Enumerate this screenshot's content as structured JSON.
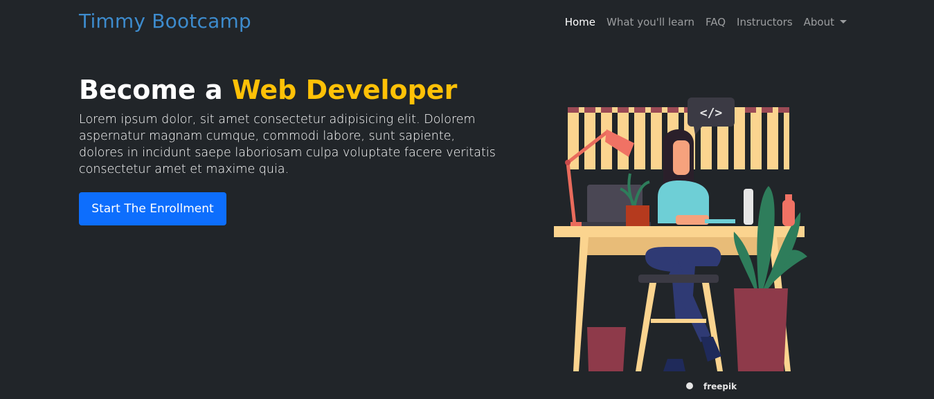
{
  "navbar": {
    "brand": "Timmy Bootcamp",
    "links": [
      {
        "label": "Home",
        "active": true
      },
      {
        "label": "What you'll learn",
        "active": false
      },
      {
        "label": "FAQ",
        "active": false
      },
      {
        "label": "Instructors",
        "active": false
      },
      {
        "label": "About",
        "active": false,
        "dropdown": true
      }
    ]
  },
  "hero": {
    "title_prefix": "Become a ",
    "title_highlight": "Web Developer",
    "description": "Lorem ipsum dolor, sit amet consectetur adipisicing elit. Dolorem aspernatur magnam cumque, commodi labore, sunt sapiente, dolores in incidunt saepe laboriosam culpa voluptate facere veritatis consectetur amet et maxime quia.",
    "cta_label": "Start The Enrollment"
  },
  "illustration": {
    "code_tag": "</>",
    "credit": "freepik"
  },
  "colors": {
    "background": "#212529",
    "brand": "#3d8bcd",
    "highlight": "#ffc107",
    "primary_button": "#0d6efd"
  }
}
